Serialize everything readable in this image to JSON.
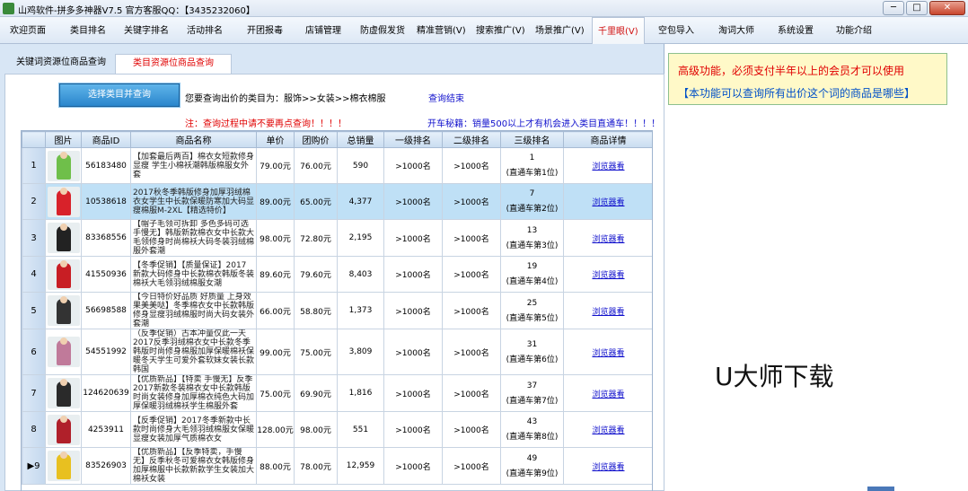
{
  "window": {
    "title": "山鸡软件-拼多多神器V7.5 官方客服QQ：【3435232060】",
    "minimize": "─",
    "maximize": "□",
    "close": "✕"
  },
  "menu": [
    "欢迎页面",
    "类目排名",
    "关键字排名",
    "活动排名",
    "开团报毒",
    "店铺管理",
    "防虚假发货",
    "精准营销(V)",
    "搜索推广(V)",
    "场景推广(V)",
    "千里眼(V)",
    "空包导入",
    "淘词大师",
    "系统设置",
    "功能介绍"
  ],
  "tabs": [
    "关键词资源位商品查询",
    "类目资源位商品查询"
  ],
  "query": {
    "button": "选择类目并查询",
    "category_text": "您要查询出价的类目为：服饰>>女装>>棉衣棉服",
    "status": "查询结束",
    "note": "注：查询过程中请不要再点查询！！！！",
    "tip": "开车秘籍：销量500以上才有机会进入类目直通车！！！！"
  },
  "table": {
    "headers": [
      "",
      "图片",
      "商品ID",
      "商品名称",
      "单价",
      "团购价",
      "总销量",
      "一级排名",
      "二级排名",
      "三级排名",
      "商品详情"
    ],
    "rows": [
      {
        "n": "1",
        "id": "56183480",
        "name": "【加套最后两百】棉衣女短款修身显瘦 学生小棉袄潮韩版棉服女外套",
        "price": "79.00元",
        "group": "76.00元",
        "sales": "590",
        "r1": ">1000名",
        "r2": ">1000名",
        "r3a": "1",
        "r3b": "(直通车第1位)",
        "link": "浏览器看",
        "color": "#6fbf4a"
      },
      {
        "n": "2",
        "id": "10538618",
        "name": "2017秋冬季韩版修身加厚羽绒棉衣女学生中长款保暖防寒加大码显瘦棉服M-2XL【精选特价】",
        "price": "89.00元",
        "group": "65.00元",
        "sales": "4,377",
        "r1": ">1000名",
        "r2": ">1000名",
        "r3a": "7",
        "r3b": "(直通车第2位)",
        "link": "浏览器看",
        "color": "#d8222a"
      },
      {
        "n": "3",
        "id": "83368556",
        "name": "【帽子毛领可拆卸 多色多码可选手慢无】韩版新款棉衣女中长款大毛领修身时尚棉袄大码冬装羽绒棉服外套潮",
        "price": "98.00元",
        "group": "72.80元",
        "sales": "2,195",
        "r1": ">1000名",
        "r2": ">1000名",
        "r3a": "13",
        "r3b": "(直通车第3位)",
        "link": "浏览器看",
        "color": "#222222"
      },
      {
        "n": "4",
        "id": "41550936",
        "name": "【冬季促销】【质量保证】2017新款大码修身中长款棉衣韩版冬装棉袄大毛领羽绒棉服女潮",
        "price": "89.60元",
        "group": "79.60元",
        "sales": "8,403",
        "r1": ">1000名",
        "r2": ">1000名",
        "r3a": "19",
        "r3b": "(直通车第4位)",
        "link": "浏览器看",
        "color": "#c81e24"
      },
      {
        "n": "5",
        "id": "56698588",
        "name": "【今日特价好品质 好质量 上身效果美美哒】冬季棉衣女中长款韩版修身显瘦羽绒棉服时尚大码女装外套潮",
        "price": "66.00元",
        "group": "58.80元",
        "sales": "1,373",
        "r1": ">1000名",
        "r2": ">1000名",
        "r3a": "25",
        "r3b": "(直通车第5位)",
        "link": "浏览器看",
        "color": "#333333"
      },
      {
        "n": "6",
        "id": "54551992",
        "name": "（反季促销）古本冲量仅此一天2017反季羽绒棉衣女中长款冬季韩版时尚修身棉服加厚保暖棉袄保暖冬天学生可爱外套软妹女装长款韩国",
        "price": "99.00元",
        "group": "75.00元",
        "sales": "3,809",
        "r1": ">1000名",
        "r2": ">1000名",
        "r3a": "31",
        "r3b": "(直通车第6位)",
        "link": "浏览器看",
        "color": "#c07a9a"
      },
      {
        "n": "7",
        "id": "124620639",
        "name": "【优质新品】【特卖 手慢无】反季2017新款冬装棉衣女中长款韩版时尚女装修身加厚棉衣纯色大码加厚保暖羽绒棉袄学生棉服外套",
        "price": "75.00元",
        "group": "69.90元",
        "sales": "1,816",
        "r1": ">1000名",
        "r2": ">1000名",
        "r3a": "37",
        "r3b": "(直通车第7位)",
        "link": "浏览器看",
        "color": "#2a2a2a"
      },
      {
        "n": "8",
        "id": "4253911",
        "name": "【反季促销】2017冬季新款中长款时尚修身大毛领羽绒棉服女保暖显瘦女装加厚气质棉衣女",
        "price": "128.00元",
        "group": "98.00元",
        "sales": "551",
        "r1": ">1000名",
        "r2": ">1000名",
        "r3a": "43",
        "r3b": "(直通车第8位)",
        "link": "浏览器看",
        "color": "#b0202a"
      },
      {
        "n": "▶9",
        "id": "83526903",
        "name": "【优质新品】【反季特卖，手慢无】反季秋冬可爱棉衣女韩版修身加厚棉服中长款新款学生女装加大棉袄女装",
        "price": "88.00元",
        "group": "78.00元",
        "sales": "12,959",
        "r1": ">1000名",
        "r2": ">1000名",
        "r3a": "49",
        "r3b": "(直通车第9位)",
        "link": "浏览器看",
        "color": "#e8c020"
      }
    ]
  },
  "right": {
    "line1": "高级功能，必须支付半年以上的会员才可以使用",
    "line2": "【本功能可以查询所有出价这个词的商品是哪些】",
    "watermark": "U大师下载"
  }
}
